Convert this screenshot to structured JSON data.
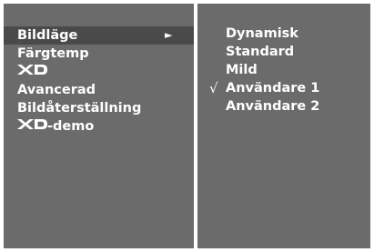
{
  "left_menu": {
    "items": [
      {
        "label": "Bildläge",
        "arrow": "►"
      },
      {
        "label": "Färgtemp"
      },
      {
        "logo": "XD",
        "label": ""
      },
      {
        "label": "Avancerad"
      },
      {
        "label": "Bildåterställning"
      },
      {
        "logo": "XD",
        "label": "-demo"
      }
    ]
  },
  "right_menu": {
    "check_mark": "√",
    "items": [
      {
        "label": "Dynamisk"
      },
      {
        "label": "Standard"
      },
      {
        "label": "Mild"
      },
      {
        "label": "Användare 1",
        "checked": true
      },
      {
        "label": "Användare 2"
      }
    ]
  },
  "colors": {
    "panel": "#6b6b6b",
    "selected": "#4a4a4a",
    "divider": "#ffffff",
    "text": "#ffffff"
  }
}
